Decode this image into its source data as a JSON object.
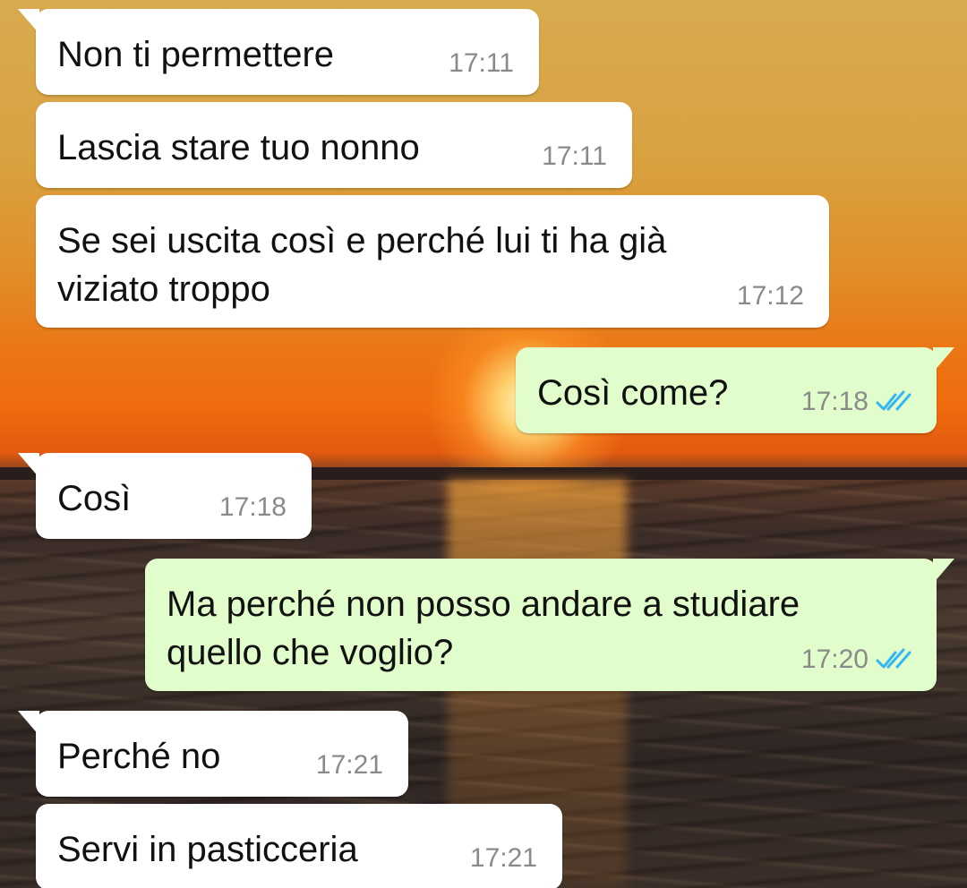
{
  "messages": [
    {
      "direction": "incoming",
      "text": "Non ti permettere",
      "time": "17:11"
    },
    {
      "direction": "incoming",
      "text": "Lascia stare tuo nonno",
      "time": "17:11"
    },
    {
      "direction": "incoming",
      "text": "Se sei uscita così e perché lui ti ha già\nviziato troppo",
      "time": "17:12"
    },
    {
      "direction": "outgoing",
      "text": "Così come?",
      "time": "17:18",
      "status_icon": "double-check-icon",
      "status_color": "#34b7f1"
    },
    {
      "direction": "incoming",
      "text": "Così",
      "time": "17:18"
    },
    {
      "direction": "outgoing",
      "text": "Ma perché non posso andare a studiare\nquello che voglio?",
      "time": "17:20",
      "status_icon": "double-check-icon",
      "status_color": "#34b7f1"
    },
    {
      "direction": "incoming",
      "text": "Perché no",
      "time": "17:21"
    },
    {
      "direction": "incoming",
      "text": "Servi in pasticceria",
      "time": "17:21"
    }
  ],
  "colors": {
    "incoming_bubble": "#ffffff",
    "outgoing_bubble": "#e1fdcb",
    "read_receipt": "#34b7f1",
    "timestamp": "#8a8a8a"
  },
  "wallpaper": "sunset-over-sea"
}
